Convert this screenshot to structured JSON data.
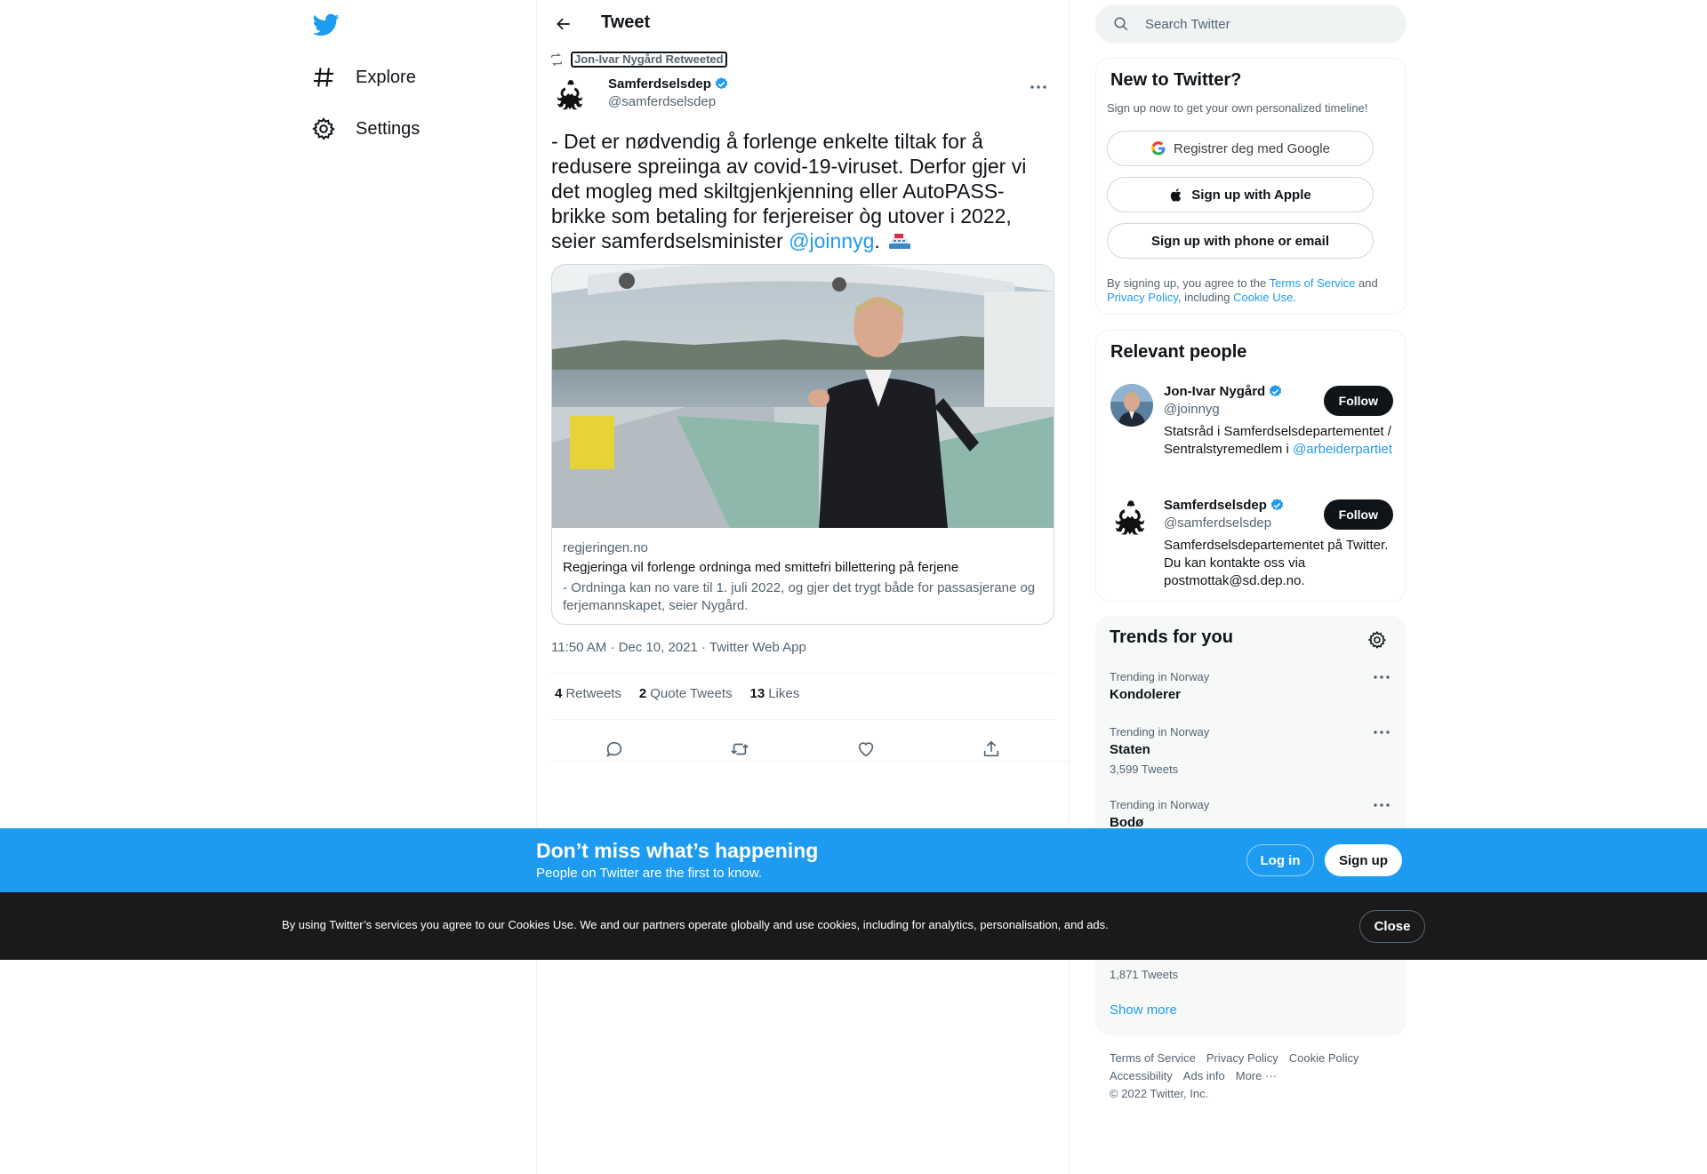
{
  "nav": {
    "items": [
      {
        "label": "Explore",
        "icon": "hashtag-icon"
      },
      {
        "label": "Settings",
        "icon": "gear-icon"
      }
    ]
  },
  "header": {
    "title": "Tweet"
  },
  "tweet": {
    "retweeted_by": "Jon-Ivar Nygård Retweeted",
    "author_name": "Samferdselsdep",
    "author_handle": "@samferdselsdep",
    "text_before": "- Det er nødvendig å forlenge enkelte tiltak for å redusere spreiinga av covid-19-viruset. Derfor gjer vi det mogleg med skiltgjenkjenning eller AutoPASS-brikke som betaling for ferjereiser òg utover i 2022, seier samferdselsminister ",
    "mention": "@joinnyg",
    "text_after": ".",
    "card": {
      "domain": "regjeringen.no",
      "title": "Regjeringa vil forlenge ordninga med smittefri billettering på ferjene",
      "description": "- Ordninga kan no vare til 1. juli 2022, og gjer det trygt både for passasjerane og ferjemannskapet, seier Nygård."
    },
    "meta": "11:50 AM · Dec 10, 2021 · Twitter Web App",
    "stats": {
      "retweets_count": "4",
      "retweets_label": "Retweets",
      "quotes_count": "2",
      "quotes_label": "Quote Tweets",
      "likes_count": "13",
      "likes_label": "Likes"
    }
  },
  "search": {
    "placeholder": "Search Twitter"
  },
  "new_to_twitter": {
    "title": "New to Twitter?",
    "subtitle": "Sign up now to get your own personalized timeline!",
    "google_label": "Registrer deg med Google",
    "apple_label": "Sign up with Apple",
    "phone_label": "Sign up with phone or email",
    "terms_1": "By signing up, you agree to the ",
    "terms_link_1": "Terms of Service",
    "terms_2": " and ",
    "terms_link_2": "Privacy Policy",
    "terms_3": ", including ",
    "terms_link_3": "Cookie Use."
  },
  "relevant_people": {
    "title": "Relevant people",
    "people": [
      {
        "name": "Jon-Ivar Nygård",
        "handle": "@joinnyg",
        "bio": "Statsråd i Samferdselsdepartementet / Sentralstyremedlem i ",
        "bio_mention": "@arbeiderpartiet",
        "follow": "Follow"
      },
      {
        "name": "Samferdselsdep",
        "handle": "@samferdselsdep",
        "bio": "Samferdselsdepartementet på Twitter. Du kan kontakte oss via postmottak@sd.dep.no.",
        "follow": "Follow"
      }
    ]
  },
  "trends": {
    "title": "Trends for you",
    "items": [
      {
        "context": "Trending in Norway",
        "name": "Kondolerer",
        "count": ""
      },
      {
        "context": "Trending in Norway",
        "name": "Staten",
        "count": "3,599 Tweets"
      },
      {
        "context": "Trending in Norway",
        "name": "Bodø",
        "count": ""
      }
    ],
    "hidden_count": "1,871 Tweets",
    "show_more": "Show more"
  },
  "footer": {
    "links_row1": [
      "Terms of Service",
      "Privacy Policy",
      "Cookie Policy"
    ],
    "links_row2": [
      "Accessibility",
      "Ads info",
      "More ···"
    ],
    "copyright": "© 2022 Twitter, Inc."
  },
  "signup_bar": {
    "title": "Don’t miss what’s happening",
    "subtitle": "People on Twitter are the first to know.",
    "login": "Log in",
    "signup": "Sign up"
  },
  "cookie_bar": {
    "text": "By using Twitter’s services you agree to our Cookies Use. We and our partners operate globally and use cookies, including for analytics, personalisation, and ads.",
    "close": "Close"
  },
  "colors": {
    "accent": "#1d9bf0",
    "signup_bar": "#1d9bf0",
    "cookie_bar": "#1a1a1a",
    "text": "#0f1419",
    "muted": "#536471"
  }
}
